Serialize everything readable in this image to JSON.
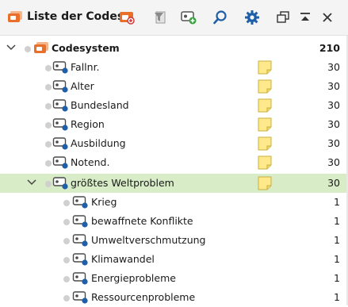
{
  "title": "Liste der Codes",
  "toolbar": {
    "icons": [
      "code-system-icon",
      "filter-icon",
      "new-code-icon",
      "search-icon",
      "settings-gear-icon",
      "undock-window-icon",
      "collapse-panel-icon",
      "close-icon"
    ]
  },
  "colors": {
    "selected_row": "#d8ecc8",
    "accent_orange": "#e8702a",
    "code_blue": "#1f5fa8",
    "memo_yellow": "#ffe98a"
  },
  "tree": {
    "root": {
      "label": "Codesystem",
      "count": "210"
    },
    "items": [
      {
        "label": "Fallnr.",
        "count": "30",
        "memo": true
      },
      {
        "label": "Alter",
        "count": "30",
        "memo": true
      },
      {
        "label": "Bundesland",
        "count": "30",
        "memo": true
      },
      {
        "label": "Region",
        "count": "30",
        "memo": true
      },
      {
        "label": "Ausbildung",
        "count": "30",
        "memo": true
      },
      {
        "label": "Notend.",
        "count": "30",
        "memo": true
      },
      {
        "label": "größtes Weltproblem",
        "count": "30",
        "memo": true,
        "selected": true,
        "expanded": true
      }
    ],
    "subitems": [
      {
        "label": "Krieg",
        "count": "1"
      },
      {
        "label": "bewaffnete Konflikte",
        "count": "1"
      },
      {
        "label": "Umweltverschmutzung",
        "count": "1"
      },
      {
        "label": "Klimawandel",
        "count": "1"
      },
      {
        "label": "Energieprobleme",
        "count": "1"
      },
      {
        "label": "Ressourcenprobleme",
        "count": "1"
      }
    ]
  }
}
